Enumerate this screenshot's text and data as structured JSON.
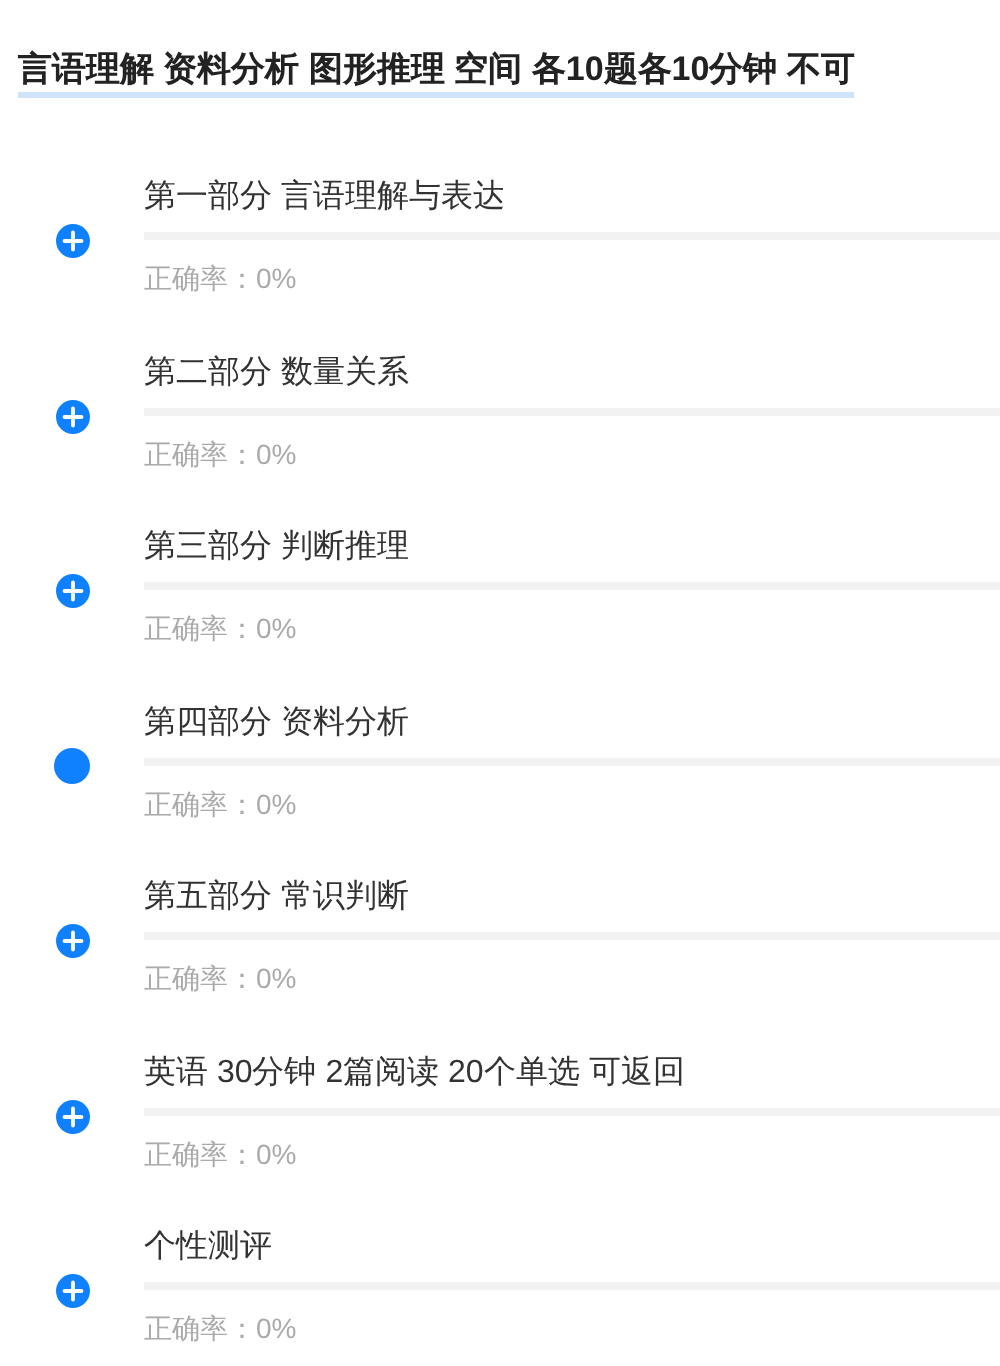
{
  "header": {
    "title": "言语理解 资料分析 图形推理 空间 各10题各10分钟 不可"
  },
  "sections": [
    {
      "kind": "plus",
      "title": "第一部分 言语理解与表达",
      "level": 0,
      "accuracy": "正确率：0%"
    },
    {
      "kind": "plus",
      "title": "第二部分 数量关系",
      "level": 0,
      "accuracy": "正确率：0%"
    },
    {
      "kind": "plus",
      "title": "第三部分 判断推理",
      "level": 0,
      "accuracy": "正确率：0%"
    },
    {
      "kind": "dot",
      "title": "第四部分 资料分析",
      "level": 0,
      "accuracy": "正确率：0%"
    },
    {
      "kind": "plus",
      "title": "第五部分 常识判断",
      "level": 0,
      "accuracy": "正确率：0%"
    },
    {
      "kind": "plus",
      "title": "英语 30分钟 2篇阅读 20个单选 可返回",
      "level": 0,
      "accuracy": "正确率：0%"
    },
    {
      "kind": "plus",
      "title": "个性测评",
      "level": 0,
      "accuracy": "正确率：0%"
    }
  ]
}
